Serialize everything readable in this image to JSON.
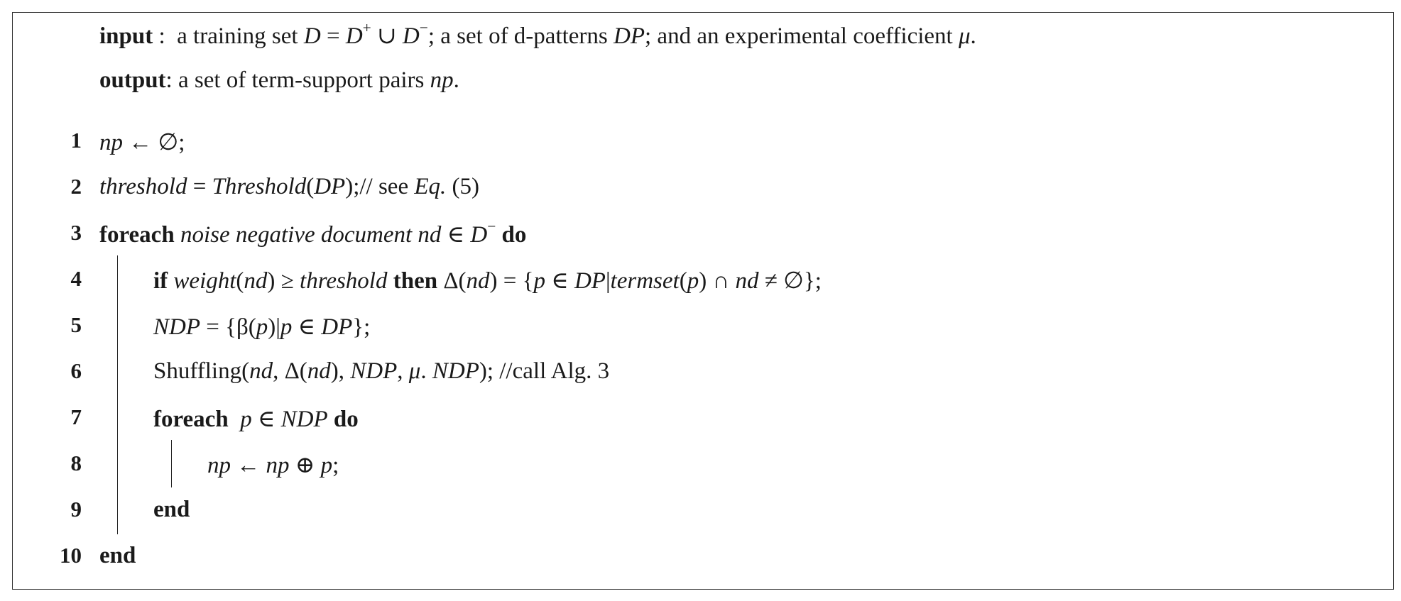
{
  "header": {
    "input_label": "input",
    "input_sep": " : ",
    "input_text_1": "a training set ",
    "input_math_1": "D",
    "input_eq": " = ",
    "input_math_2": "D",
    "input_sup_1": "+",
    "input_cup": " ∪ ",
    "input_math_3": "D",
    "input_sup_2": "−",
    "input_text_2": "; a set of d-patterns ",
    "input_math_4": "DP",
    "input_text_3": "; and an experimental coefficient ",
    "input_math_5": "μ",
    "input_text_4": ".",
    "output_label": "output",
    "output_text_1": ": a set of term-support pairs ",
    "output_math_1": "np",
    "output_text_2": "."
  },
  "lines": [
    {
      "no": "1",
      "a": "np",
      "b": " ← ∅;"
    },
    {
      "no": "2",
      "a": "threshold",
      "b": " = ",
      "c": "Threshold",
      "d": "(",
      "e": "DP",
      "f": ");// see ",
      "g": "Eq.",
      "h": " (5)"
    },
    {
      "no": "3",
      "kw1": "foreach",
      "a": " noise negative document ",
      "b": "nd",
      "c": " ∈ ",
      "d": "D",
      "sup": "−",
      "kw2": " do"
    },
    {
      "no": "4",
      "kw1": "if",
      "a": " weight",
      "b": "(",
      "c": "nd",
      "d": ") ≥ ",
      "e": "threshold",
      "kw2": " then",
      "f": " Δ(",
      "g": "nd",
      "h": ") = {",
      "i": "p",
      "j": " ∈ ",
      "k": "DP",
      "l": "|",
      "m": "termset",
      "n": "(",
      "o": "p",
      "p": ") ∩ ",
      "q": "nd",
      "r": " ≠ ∅};"
    },
    {
      "no": "5",
      "a": "NDP",
      "b": " = {β(",
      "c": "p",
      "d": ")|",
      "e": "p",
      "f": " ∈ ",
      "g": "DP",
      "h": "};"
    },
    {
      "no": "6",
      "a": "Shuffling(",
      "b": "nd",
      "c": ", Δ(",
      "d": "nd",
      "e": "), ",
      "f": "NDP",
      "g": ", ",
      "h": "μ",
      "i": ". ",
      "j": "NDP",
      "k": "); //call Alg. 3"
    },
    {
      "no": "7",
      "kw1": "foreach",
      "a": "  ",
      "b": "p",
      "c": " ∈ ",
      "d": "NDP",
      "kw2": " do"
    },
    {
      "no": "8",
      "a": "np",
      "b": " ← ",
      "c": "np",
      "d": " ⊕ ",
      "e": "p",
      "f": ";"
    },
    {
      "no": "9",
      "kw1": "end"
    },
    {
      "no": "10",
      "kw1": "end"
    }
  ]
}
